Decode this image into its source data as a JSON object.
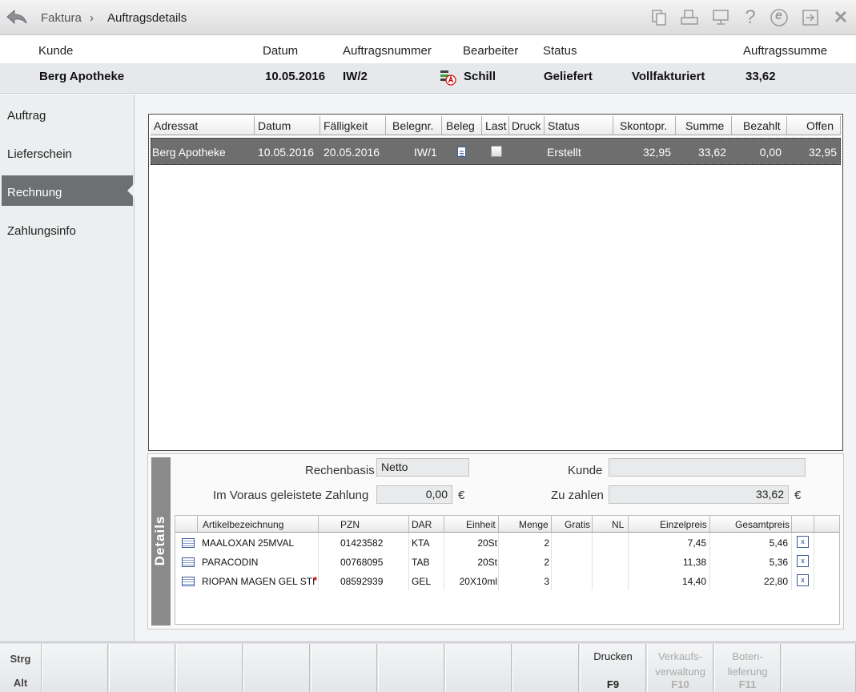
{
  "breadcrumb": {
    "root": "Faktura",
    "separator": "›",
    "current": "Auftragsdetails"
  },
  "toolbar_icons": [
    "documents-icon",
    "printer-icon",
    "monitor-icon",
    "help-icon",
    "e-icon",
    "export-icon",
    "close-icon"
  ],
  "toolbar": {
    "help_glyph": "?",
    "e_glyph": "e",
    "close_glyph": "✕"
  },
  "header": {
    "labels": {
      "kunde": "Kunde",
      "datum": "Datum",
      "auftragsnummer": "Auftragsnummer",
      "bearbeiter": "Bearbeiter",
      "status": "Status",
      "auftragssumme": "Auftragssumme"
    },
    "values": {
      "kunde": "Berg Apotheke",
      "datum": "10.05.2016",
      "auftragsnummer": "IW/2",
      "bearbeiter": "Schill",
      "status": "Geliefert",
      "status2": "Vollfakturiert",
      "auftragssumme": "33,62"
    }
  },
  "sidebar": {
    "items": [
      {
        "label": "Auftrag"
      },
      {
        "label": "Lieferschein"
      },
      {
        "label": "Rechnung"
      },
      {
        "label": "Zahlungsinfo"
      }
    ],
    "active_index": 2
  },
  "invoice_grid": {
    "columns": [
      "Adressat",
      "Datum",
      "Fälligkeit",
      "Belegnr.",
      "Beleg",
      "Last",
      "Druck",
      "Status",
      "Skontopr.",
      "Summe",
      "Bezahlt",
      "Offen"
    ],
    "rows": [
      {
        "adressat": "Berg Apotheke",
        "datum": "10.05.2016",
        "faelligkeit": "20.05.2016",
        "belegnr": "IW/1",
        "last": false,
        "status": "Erstellt",
        "skontopr": "32,95",
        "summe": "33,62",
        "bezahlt": "0,00",
        "offen": "32,95"
      }
    ]
  },
  "details": {
    "tab_label": "Details",
    "rechenbasis_label": "Rechenbasis",
    "rechenbasis_value": "Netto",
    "kunde_label": "Kunde",
    "kunde_value": "",
    "vorauszahlung_label": "Im Voraus geleistete Zahlung",
    "vorauszahlung_value": "0,00",
    "currency": "€",
    "zu_zahlen_label": "Zu zahlen",
    "zu_zahlen_value": "33,62",
    "columns": [
      "Artikelbezeichnung",
      "PZN",
      "DAR",
      "Einheit",
      "Menge",
      "Gratis",
      "NL",
      "Einzelpreis",
      "Gesamtpreis"
    ],
    "items": [
      {
        "name": "MAALOXAN 25MVAL",
        "pzn": "01423582",
        "dar": "KTA",
        "einheit": "20St",
        "menge": "2",
        "gratis": "",
        "nl": "",
        "einzelpreis": "7,45",
        "gesamtpreis": "5,46",
        "flag": ""
      },
      {
        "name": "PARACODIN",
        "pzn": "00768095",
        "dar": "TAB",
        "einheit": "20St",
        "menge": "2",
        "gratis": "",
        "nl": "",
        "einzelpreis": "11,38",
        "gesamtpreis": "5,36",
        "flag": ""
      },
      {
        "name": "RIOPAN MAGEN GEL STICK",
        "pzn": "08592939",
        "dar": "GEL",
        "einheit": "20X10ml",
        "menge": "3",
        "gratis": "",
        "nl": "",
        "einzelpreis": "14,40",
        "gesamtpreis": "22,80",
        "flag": "*"
      }
    ],
    "x_icon_glyph": "x"
  },
  "footer": {
    "modifiers": {
      "strg": "Strg",
      "alt": "Alt"
    },
    "keys": [
      {
        "label": "",
        "key": "",
        "enabled": false
      },
      {
        "label": "",
        "key": "",
        "enabled": false
      },
      {
        "label": "",
        "key": "",
        "enabled": false
      },
      {
        "label": "",
        "key": "",
        "enabled": false
      },
      {
        "label": "",
        "key": "",
        "enabled": false
      },
      {
        "label": "",
        "key": "",
        "enabled": false
      },
      {
        "label": "",
        "key": "",
        "enabled": false
      },
      {
        "label": "",
        "key": "",
        "enabled": false
      },
      {
        "label": "Drucken",
        "key": "F9",
        "enabled": true
      },
      {
        "label": "Verkaufs-\nverwaltung",
        "key": "F10",
        "enabled": false
      },
      {
        "label": "Boten-\nlieferung",
        "key": "F11",
        "enabled": false
      },
      {
        "label": "",
        "key": "",
        "enabled": false
      }
    ]
  }
}
